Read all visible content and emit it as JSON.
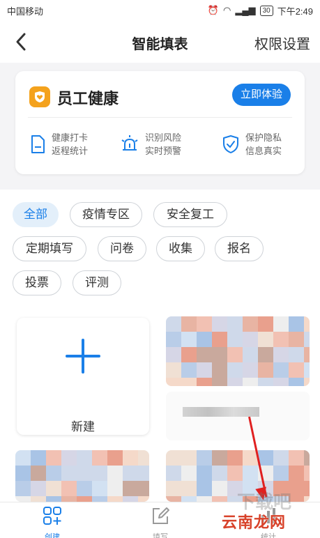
{
  "status_bar": {
    "carrier": "中国移动",
    "battery": "30",
    "time": "下午2:49"
  },
  "nav": {
    "title": "智能填表",
    "right_action": "权限设置"
  },
  "health_card": {
    "title": "员工健康",
    "try_button": "立即体验",
    "features": [
      {
        "line1": "健康打卡",
        "line2": "返程统计",
        "icon": "document-icon"
      },
      {
        "line1": "识别风险",
        "line2": "实时预警",
        "icon": "alarm-icon"
      },
      {
        "line1": "保护隐私",
        "line2": "信息真实",
        "icon": "shield-check-icon"
      }
    ]
  },
  "categories": [
    {
      "label": "全部",
      "active": true
    },
    {
      "label": "疫情专区",
      "active": false
    },
    {
      "label": "安全复工",
      "active": false
    },
    {
      "label": "定期填写",
      "active": false
    },
    {
      "label": "问卷",
      "active": false
    },
    {
      "label": "收集",
      "active": false
    },
    {
      "label": "报名",
      "active": false
    },
    {
      "label": "投票",
      "active": false
    },
    {
      "label": "评测",
      "active": false
    }
  ],
  "new_card": {
    "label": "新建"
  },
  "tabs": [
    {
      "label": "创建",
      "icon": "grid-plus-icon",
      "active": true
    },
    {
      "label": "填写",
      "icon": "edit-icon",
      "active": false
    },
    {
      "label": "统计",
      "icon": "chart-icon",
      "active": false
    }
  ],
  "watermark": {
    "text": "云南龙网",
    "overlay": "下载吧"
  },
  "colors": {
    "accent": "#1a7fe8",
    "orange": "#f4a21d",
    "arrow": "#e02020"
  }
}
